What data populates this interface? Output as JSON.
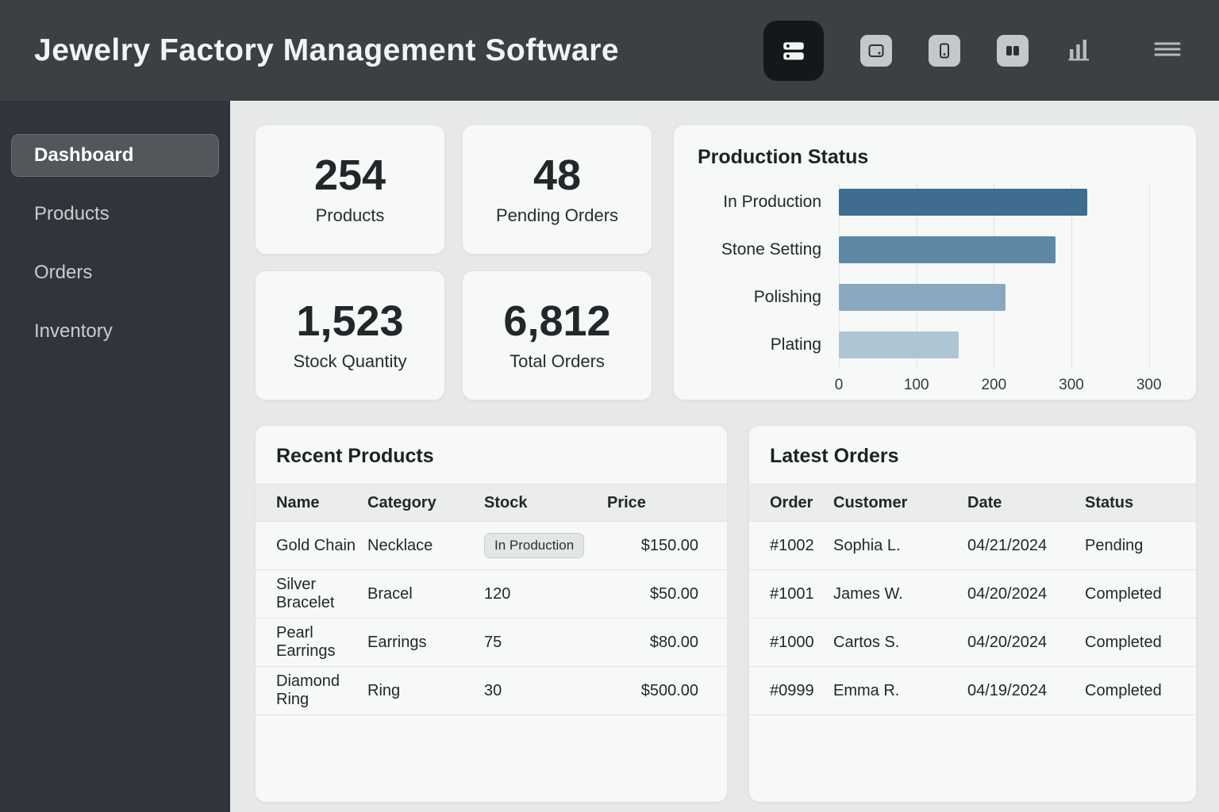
{
  "header": {
    "title": "Jewelry Factory Management Software",
    "icons": [
      "dashboard-view-icon",
      "card-view-icon",
      "device-view-icon",
      "split-view-icon",
      "bar-chart-icon",
      "menu-icon"
    ]
  },
  "sidebar": {
    "items": [
      {
        "label": "Dashboard",
        "active": true
      },
      {
        "label": "Products",
        "active": false
      },
      {
        "label": "Orders",
        "active": false
      },
      {
        "label": "Inventory",
        "active": false
      }
    ]
  },
  "stats": [
    {
      "value": "254",
      "label": "Products"
    },
    {
      "value": "48",
      "label": "Pending Orders"
    },
    {
      "value": "1,523",
      "label": "Stock Quantity"
    },
    {
      "value": "6,812",
      "label": "Total Orders"
    }
  ],
  "chart_data": {
    "type": "bar",
    "orientation": "horizontal",
    "title": "Production Status",
    "categories": [
      "In Production",
      "Stone Setting",
      "Polishing",
      "Plating"
    ],
    "values": [
      320,
      280,
      215,
      155
    ],
    "xlim": [
      0,
      430
    ],
    "tick_values": [
      0,
      100,
      200,
      300,
      400
    ],
    "tick_labels": [
      "0",
      "100",
      "200",
      "300",
      "300"
    ],
    "bar_colors": [
      "#3e6d90",
      "#5d88a6",
      "#87a8bf",
      "#aec5d4"
    ],
    "grid": true,
    "legend": false,
    "xlabel": "",
    "ylabel": ""
  },
  "recent_products": {
    "title": "Recent Products",
    "columns": [
      "Name",
      "Category",
      "Stock",
      "Price"
    ],
    "rows": [
      {
        "name": "Gold Chain",
        "category": "Necklace",
        "stock": "In Production",
        "price": "$150.00"
      },
      {
        "name": "Silver Bracelet",
        "category": "Bracel",
        "stock": "120",
        "price": "$50.00"
      },
      {
        "name": "Pearl Earrings",
        "category": "Earrings",
        "stock": "75",
        "price": "$80.00"
      },
      {
        "name": "Diamond Ring",
        "category": "Ring",
        "stock": "30",
        "price": "$500.00"
      }
    ]
  },
  "latest_orders": {
    "title": "Latest Orders",
    "columns": [
      "Order",
      "Customer",
      "Date",
      "Status"
    ],
    "rows": [
      {
        "order": "#1002",
        "customer": "Sophia L.",
        "date": "04/21/2024",
        "status": "Pending"
      },
      {
        "order": "#1001",
        "customer": "James W.",
        "date": "04/20/2024",
        "status": "Completed"
      },
      {
        "order": "#1000",
        "customer": "Cartos S.",
        "date": "04/20/2024",
        "status": "Completed"
      },
      {
        "order": "#0999",
        "customer": "Emma R.",
        "date": "04/19/2024",
        "status": "Completed"
      }
    ]
  }
}
